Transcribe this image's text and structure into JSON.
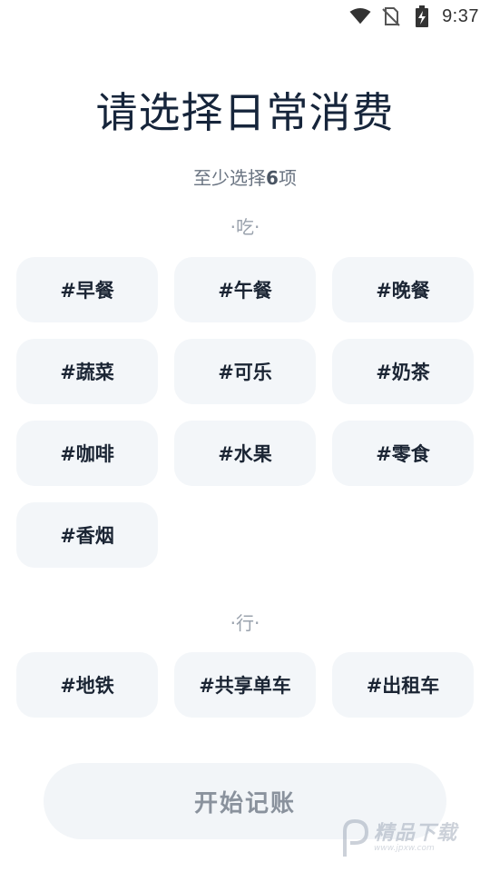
{
  "status_bar": {
    "time": "9:37",
    "icons": [
      "wifi-icon",
      "no-sim-icon",
      "battery-charging-icon"
    ]
  },
  "header": {
    "title": "请选择日常消费",
    "subtitle_prefix": "至少选择",
    "subtitle_count": "6",
    "subtitle_suffix": "项"
  },
  "sections": {
    "eat": {
      "label": "·吃·",
      "items": [
        "#早餐",
        "#午餐",
        "#晚餐",
        "#蔬菜",
        "#可乐",
        "#奶茶",
        "#咖啡",
        "#水果",
        "#零食",
        "#香烟"
      ]
    },
    "travel": {
      "label": "·行·",
      "items": [
        "#地铁",
        "#共享单车",
        "#出租车"
      ]
    }
  },
  "start_button": {
    "label": "开始记账"
  },
  "watermark": {
    "text": "精品下载",
    "url": "www.jpxw.com"
  },
  "colors": {
    "chip_background": "#f3f6f9",
    "title": "#16253b",
    "button_text": "#8a929d"
  }
}
